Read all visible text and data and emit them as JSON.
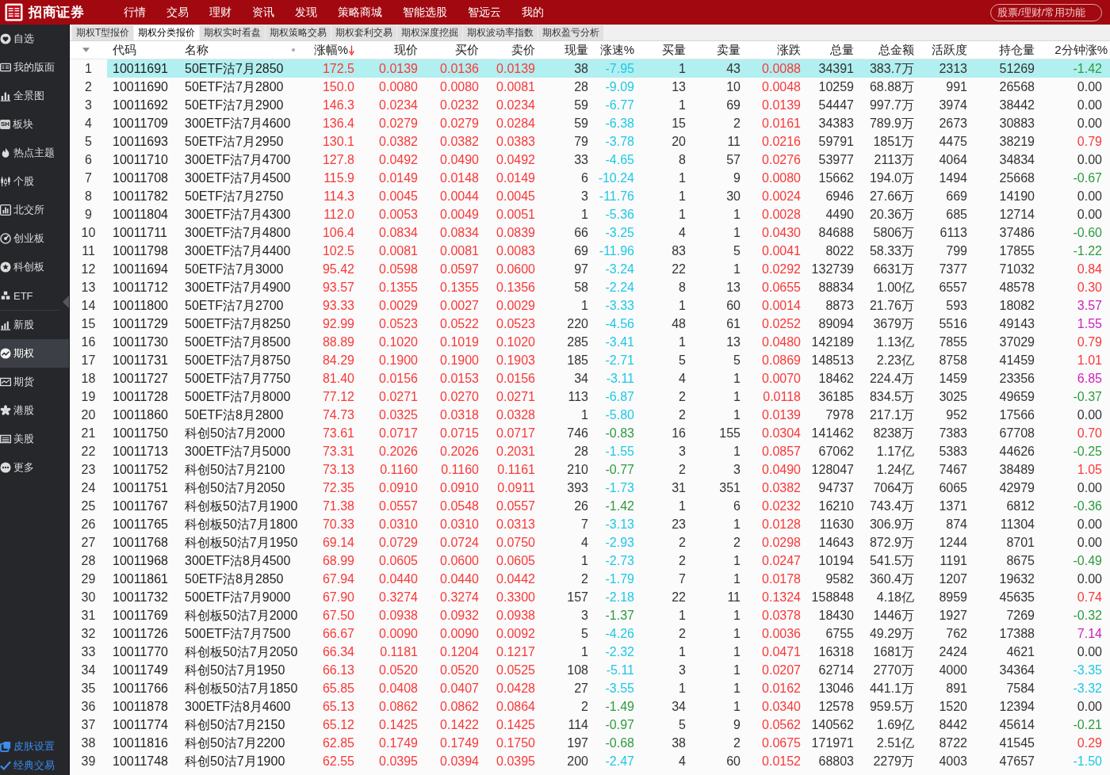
{
  "top_bar": {
    "brand": "招商证券",
    "menu": [
      "行情",
      "交易",
      "理财",
      "资讯",
      "发现",
      "策略商城",
      "智能选股",
      "智远云",
      "我的"
    ],
    "search": {
      "placeholder": "股票/理财/常用功能"
    }
  },
  "sidebar": {
    "sections": [
      {
        "items": [
          {
            "label": "自选",
            "selected": false
          },
          {
            "label": "我的版面",
            "selected": false
          },
          {
            "label": "全景图",
            "selected": false
          },
          {
            "label": "板块",
            "badge": "SH",
            "selected": false
          },
          {
            "label": "热点主题",
            "selected": false
          },
          {
            "label": "个股",
            "selected": false
          },
          {
            "label": "北交所",
            "selected": false
          },
          {
            "label": "创业板",
            "selected": false
          },
          {
            "label": "科创板",
            "selected": false
          },
          {
            "label": "ETF",
            "selected": false
          }
        ]
      },
      {
        "items": [
          {
            "label": "新股",
            "selected": false
          },
          {
            "label": "期权",
            "selected": true
          },
          {
            "label": "期货",
            "selected": false
          },
          {
            "label": "港股",
            "selected": false
          },
          {
            "label": "美股",
            "selected": false
          },
          {
            "label": "更多",
            "selected": false
          }
        ]
      }
    ],
    "footer": [
      "皮肤设置",
      "经典交易"
    ]
  },
  "tabs": [
    {
      "label": "期权T型报价",
      "selected": false
    },
    {
      "label": "期权分类报价",
      "selected": true
    },
    {
      "label": "期权实时看盘",
      "selected": false
    },
    {
      "label": "期权策略交易",
      "selected": false
    },
    {
      "label": "期权套利交易",
      "selected": false
    },
    {
      "label": "期权深度挖掘",
      "selected": false
    },
    {
      "label": "期权波动率指数",
      "selected": false
    },
    {
      "label": "期权盈亏分析",
      "selected": false
    }
  ],
  "table": {
    "columns": [
      {
        "label": "代码",
        "sorted": false
      },
      {
        "label": "名称",
        "sorted": false
      },
      {
        "label": "涨幅%",
        "sorted": true
      },
      {
        "label": "现价",
        "sorted": false
      },
      {
        "label": "买价",
        "sorted": false
      },
      {
        "label": "卖价",
        "sorted": false
      },
      {
        "label": "现量",
        "sorted": false
      },
      {
        "label": "涨速%",
        "sorted": false
      },
      {
        "label": "买量",
        "sorted": false
      },
      {
        "label": "卖量",
        "sorted": false
      },
      {
        "label": "涨跌",
        "sorted": false
      },
      {
        "label": "总量",
        "sorted": false
      },
      {
        "label": "总金额",
        "sorted": false
      },
      {
        "label": "活跃度",
        "sorted": false
      },
      {
        "label": "持仓量",
        "sorted": false
      },
      {
        "label": "2分钟涨%",
        "sorted": false
      }
    ],
    "rows": [
      {
        "no": "1",
        "selected": true,
        "cells": [
          "10011691",
          "50ETF沽7月2850",
          "172.5",
          "0.0139",
          "0.0136",
          "0.0139",
          "38",
          {
            "text": "-7.95",
            "color": "#1ec8e6"
          },
          "1",
          "43",
          "0.0088",
          "34391",
          "383.7万",
          "2313",
          "51269",
          {
            "text": "-1.42",
            "color": "#2e9b3f"
          }
        ]
      },
      {
        "no": "2",
        "selected": false,
        "cells": [
          "10011690",
          "50ETF沽7月2800",
          "150.0",
          "0.0080",
          "0.0080",
          "0.0081",
          "28",
          {
            "text": "-9.09",
            "color": "#1ec8e6"
          },
          "13",
          "10",
          "0.0048",
          "10259",
          "68.88万",
          "991",
          "26568",
          {
            "text": "0.00",
            "color": "#333333"
          }
        ]
      },
      {
        "no": "3",
        "selected": false,
        "cells": [
          "10011692",
          "50ETF沽7月2900",
          "146.3",
          "0.0234",
          "0.0232",
          "0.0234",
          "59",
          {
            "text": "-6.77",
            "color": "#1ec8e6"
          },
          "1",
          "69",
          "0.0139",
          "54447",
          "997.7万",
          "3974",
          "38442",
          {
            "text": "0.00",
            "color": "#333333"
          }
        ]
      },
      {
        "no": "4",
        "selected": false,
        "cells": [
          "10011709",
          "300ETF沽7月4600",
          "136.4",
          "0.0279",
          "0.0279",
          "0.0284",
          "59",
          {
            "text": "-6.38",
            "color": "#1ec8e6"
          },
          "15",
          "2",
          "0.0161",
          "34383",
          "789.9万",
          "2673",
          "30883",
          {
            "text": "0.00",
            "color": "#333333"
          }
        ]
      },
      {
        "no": "5",
        "selected": false,
        "cells": [
          "10011693",
          "50ETF沽7月2950",
          "130.1",
          "0.0382",
          "0.0382",
          "0.0383",
          "79",
          {
            "text": "-3.78",
            "color": "#1ec8e6"
          },
          "20",
          "11",
          "0.0216",
          "59791",
          "1851万",
          "4475",
          "38219",
          {
            "text": "0.79",
            "color": "#f93838"
          }
        ]
      },
      {
        "no": "6",
        "selected": false,
        "cells": [
          "10011710",
          "300ETF沽7月4700",
          "127.8",
          "0.0492",
          "0.0490",
          "0.0492",
          "33",
          {
            "text": "-4.65",
            "color": "#1ec8e6"
          },
          "8",
          "57",
          "0.0276",
          "53977",
          "2113万",
          "4064",
          "34834",
          {
            "text": "0.00",
            "color": "#333333"
          }
        ]
      },
      {
        "no": "7",
        "selected": false,
        "cells": [
          "10011708",
          "300ETF沽7月4500",
          "115.9",
          "0.0149",
          "0.0148",
          "0.0149",
          "6",
          {
            "text": "-10.24",
            "color": "#1ec8e6"
          },
          "1",
          "9",
          "0.0080",
          "15662",
          "194.0万",
          "1494",
          "25668",
          {
            "text": "-0.67",
            "color": "#2e9b3f"
          }
        ]
      },
      {
        "no": "8",
        "selected": false,
        "cells": [
          "10011782",
          "50ETF沽7月2750",
          "114.3",
          "0.0045",
          "0.0044",
          "0.0045",
          "3",
          {
            "text": "-11.76",
            "color": "#1ec8e6"
          },
          "1",
          "30",
          "0.0024",
          "6946",
          "27.66万",
          "669",
          "14190",
          {
            "text": "0.00",
            "color": "#333333"
          }
        ]
      },
      {
        "no": "9",
        "selected": false,
        "cells": [
          "10011804",
          "300ETF沽7月4300",
          "112.0",
          "0.0053",
          "0.0049",
          "0.0051",
          "1",
          {
            "text": "-5.36",
            "color": "#1ec8e6"
          },
          "1",
          "1",
          "0.0028",
          "4490",
          "20.36万",
          "685",
          "12714",
          {
            "text": "0.00",
            "color": "#333333"
          }
        ]
      },
      {
        "no": "10",
        "selected": false,
        "cells": [
          "10011711",
          "300ETF沽7月4800",
          "106.4",
          "0.0834",
          "0.0834",
          "0.0839",
          "66",
          {
            "text": "-3.25",
            "color": "#1ec8e6"
          },
          "4",
          "1",
          "0.0430",
          "84688",
          "5806万",
          "6113",
          "37486",
          {
            "text": "-0.60",
            "color": "#2e9b3f"
          }
        ]
      },
      {
        "no": "11",
        "selected": false,
        "cells": [
          "10011798",
          "300ETF沽7月4400",
          "102.5",
          "0.0081",
          "0.0081",
          "0.0083",
          "69",
          {
            "text": "-11.96",
            "color": "#1ec8e6"
          },
          "83",
          "5",
          "0.0041",
          "8022",
          "58.33万",
          "799",
          "17855",
          {
            "text": "-1.22",
            "color": "#2e9b3f"
          }
        ]
      },
      {
        "no": "12",
        "selected": false,
        "cells": [
          "10011694",
          "50ETF沽7月3000",
          "95.42",
          "0.0598",
          "0.0597",
          "0.0600",
          "97",
          {
            "text": "-3.24",
            "color": "#1ec8e6"
          },
          "22",
          "1",
          "0.0292",
          "132739",
          "6631万",
          "7377",
          "71032",
          {
            "text": "0.84",
            "color": "#f93838"
          }
        ]
      },
      {
        "no": "13",
        "selected": false,
        "cells": [
          "10011712",
          "300ETF沽7月4900",
          "93.57",
          "0.1355",
          "0.1355",
          "0.1356",
          "58",
          {
            "text": "-2.24",
            "color": "#1ec8e6"
          },
          "8",
          "13",
          "0.0655",
          "88834",
          "1.00亿",
          "6557",
          "48578",
          {
            "text": "0.30",
            "color": "#f93838"
          }
        ]
      },
      {
        "no": "14",
        "selected": false,
        "cells": [
          "10011800",
          "50ETF沽7月2700",
          "93.33",
          "0.0029",
          "0.0027",
          "0.0029",
          "1",
          {
            "text": "-3.33",
            "color": "#1ec8e6"
          },
          "1",
          "60",
          "0.0014",
          "8873",
          "21.76万",
          "593",
          "18082",
          {
            "text": "3.57",
            "color": "#cc22bb"
          }
        ]
      },
      {
        "no": "15",
        "selected": false,
        "cells": [
          "10011729",
          "500ETF沽7月8250",
          "92.99",
          "0.0523",
          "0.0522",
          "0.0523",
          "220",
          {
            "text": "-4.56",
            "color": "#1ec8e6"
          },
          "48",
          "61",
          "0.0252",
          "89094",
          "3679万",
          "5516",
          "49143",
          {
            "text": "1.55",
            "color": "#cc22bb"
          }
        ]
      },
      {
        "no": "16",
        "selected": false,
        "cells": [
          "10011730",
          "500ETF沽7月8500",
          "88.89",
          "0.1020",
          "0.1019",
          "0.1020",
          "285",
          {
            "text": "-3.41",
            "color": "#1ec8e6"
          },
          "1",
          "13",
          "0.0480",
          "142189",
          "1.13亿",
          "7855",
          "37029",
          {
            "text": "0.79",
            "color": "#f93838"
          }
        ]
      },
      {
        "no": "17",
        "selected": false,
        "cells": [
          "10011731",
          "500ETF沽7月8750",
          "84.29",
          "0.1900",
          "0.1900",
          "0.1903",
          "185",
          {
            "text": "-2.71",
            "color": "#1ec8e6"
          },
          "5",
          "5",
          "0.0869",
          "148513",
          "2.23亿",
          "8758",
          "41459",
          {
            "text": "1.01",
            "color": "#f93838"
          }
        ]
      },
      {
        "no": "18",
        "selected": false,
        "cells": [
          "10011727",
          "500ETF沽7月7750",
          "81.40",
          "0.0156",
          "0.0153",
          "0.0156",
          "34",
          {
            "text": "-3.11",
            "color": "#1ec8e6"
          },
          "4",
          "1",
          "0.0070",
          "18462",
          "224.4万",
          "1459",
          "23356",
          {
            "text": "6.85",
            "color": "#cc22bb"
          }
        ]
      },
      {
        "no": "19",
        "selected": false,
        "cells": [
          "10011728",
          "500ETF沽7月8000",
          "77.12",
          "0.0271",
          "0.0270",
          "0.0271",
          "113",
          {
            "text": "-6.87",
            "color": "#1ec8e6"
          },
          "2",
          "1",
          "0.0118",
          "36185",
          "834.5万",
          "3025",
          "49659",
          {
            "text": "-0.37",
            "color": "#2e9b3f"
          }
        ]
      },
      {
        "no": "20",
        "selected": false,
        "cells": [
          "10011860",
          "50ETF沽8月2800",
          "74.73",
          "0.0325",
          "0.0318",
          "0.0328",
          "1",
          {
            "text": "-5.80",
            "color": "#1ec8e6"
          },
          "2",
          "1",
          "0.0139",
          "7978",
          "217.1万",
          "952",
          "17566",
          {
            "text": "0.00",
            "color": "#333333"
          }
        ]
      },
      {
        "no": "21",
        "selected": false,
        "cells": [
          "10011750",
          "科创50沽7月2000",
          "73.61",
          "0.0717",
          "0.0715",
          "0.0717",
          "746",
          {
            "text": "-0.83",
            "color": "#2e9b3f"
          },
          "16",
          "155",
          "0.0304",
          "141462",
          "8238万",
          "7383",
          "67708",
          {
            "text": "0.70",
            "color": "#f93838"
          }
        ]
      },
      {
        "no": "22",
        "selected": false,
        "cells": [
          "10011713",
          "300ETF沽7月5000",
          "73.31",
          "0.2026",
          "0.2026",
          "0.2031",
          "28",
          {
            "text": "-1.55",
            "color": "#1ec8e6"
          },
          "3",
          "1",
          "0.0857",
          "67062",
          "1.17亿",
          "5383",
          "44626",
          {
            "text": "-0.25",
            "color": "#2e9b3f"
          }
        ]
      },
      {
        "no": "23",
        "selected": false,
        "cells": [
          "10011752",
          "科创50沽7月2100",
          "73.13",
          "0.1160",
          "0.1160",
          "0.1161",
          "210",
          {
            "text": "-0.77",
            "color": "#2e9b3f"
          },
          "2",
          "3",
          "0.0490",
          "128047",
          "1.24亿",
          "7467",
          "38489",
          {
            "text": "1.05",
            "color": "#f93838"
          }
        ]
      },
      {
        "no": "24",
        "selected": false,
        "cells": [
          "10011751",
          "科创50沽7月2050",
          "72.35",
          "0.0910",
          "0.0910",
          "0.0911",
          "393",
          {
            "text": "-1.73",
            "color": "#1ec8e6"
          },
          "31",
          "351",
          "0.0382",
          "94737",
          "7064万",
          "6065",
          "42979",
          {
            "text": "0.00",
            "color": "#333333"
          }
        ]
      },
      {
        "no": "25",
        "selected": false,
        "cells": [
          "10011767",
          "科创板50沽7月1900",
          "71.38",
          "0.0557",
          "0.0548",
          "0.0557",
          "26",
          {
            "text": "-1.42",
            "color": "#2e9b3f"
          },
          "1",
          "6",
          "0.0232",
          "16210",
          "743.4万",
          "1371",
          "6812",
          {
            "text": "-0.36",
            "color": "#2e9b3f"
          }
        ]
      },
      {
        "no": "26",
        "selected": false,
        "cells": [
          "10011765",
          "科创板50沽7月1800",
          "70.33",
          "0.0310",
          "0.0310",
          "0.0313",
          "7",
          {
            "text": "-3.13",
            "color": "#1ec8e6"
          },
          "23",
          "1",
          "0.0128",
          "11630",
          "306.9万",
          "874",
          "11304",
          {
            "text": "0.00",
            "color": "#333333"
          }
        ]
      },
      {
        "no": "27",
        "selected": false,
        "cells": [
          "10011768",
          "科创板50沽7月1950",
          "69.14",
          "0.0729",
          "0.0724",
          "0.0750",
          "4",
          {
            "text": "-2.93",
            "color": "#1ec8e6"
          },
          "2",
          "2",
          "0.0298",
          "14643",
          "872.9万",
          "1244",
          "8701",
          {
            "text": "0.00",
            "color": "#333333"
          }
        ]
      },
      {
        "no": "28",
        "selected": false,
        "cells": [
          "10011968",
          "300ETF沽8月4500",
          "68.99",
          "0.0605",
          "0.0600",
          "0.0605",
          "1",
          {
            "text": "-2.73",
            "color": "#1ec8e6"
          },
          "2",
          "1",
          "0.0247",
          "10194",
          "541.5万",
          "1191",
          "8675",
          {
            "text": "-0.49",
            "color": "#2e9b3f"
          }
        ]
      },
      {
        "no": "29",
        "selected": false,
        "cells": [
          "10011861",
          "50ETF沽8月2850",
          "67.94",
          "0.0440",
          "0.0440",
          "0.0442",
          "2",
          {
            "text": "-1.79",
            "color": "#1ec8e6"
          },
          "7",
          "1",
          "0.0178",
          "9582",
          "360.4万",
          "1207",
          "19632",
          {
            "text": "0.00",
            "color": "#333333"
          }
        ]
      },
      {
        "no": "30",
        "selected": false,
        "cells": [
          "10011732",
          "500ETF沽7月9000",
          "67.90",
          "0.3274",
          "0.3274",
          "0.3300",
          "157",
          {
            "text": "-2.18",
            "color": "#1ec8e6"
          },
          "22",
          "11",
          "0.1324",
          "158848",
          "4.18亿",
          "8959",
          "45635",
          {
            "text": "0.74",
            "color": "#f93838"
          }
        ]
      },
      {
        "no": "31",
        "selected": false,
        "cells": [
          "10011769",
          "科创板50沽7月2000",
          "67.50",
          "0.0938",
          "0.0932",
          "0.0938",
          "3",
          {
            "text": "-1.37",
            "color": "#2e9b3f"
          },
          "1",
          "1",
          "0.0378",
          "18430",
          "1446万",
          "1927",
          "7269",
          {
            "text": "-0.32",
            "color": "#2e9b3f"
          }
        ]
      },
      {
        "no": "32",
        "selected": false,
        "cells": [
          "10011726",
          "500ETF沽7月7500",
          "66.67",
          "0.0090",
          "0.0090",
          "0.0092",
          "5",
          {
            "text": "-4.26",
            "color": "#1ec8e6"
          },
          "2",
          "1",
          "0.0036",
          "6755",
          "49.29万",
          "762",
          "17388",
          {
            "text": "7.14",
            "color": "#cc22bb"
          }
        ]
      },
      {
        "no": "33",
        "selected": false,
        "cells": [
          "10011770",
          "科创板50沽7月2050",
          "66.34",
          "0.1181",
          "0.1204",
          "0.1217",
          "1",
          {
            "text": "-2.32",
            "color": "#1ec8e6"
          },
          "1",
          "1",
          "0.0471",
          "16318",
          "1681万",
          "2424",
          "4621",
          {
            "text": "0.00",
            "color": "#333333"
          }
        ]
      },
      {
        "no": "34",
        "selected": false,
        "cells": [
          "10011749",
          "科创50沽7月1950",
          "66.13",
          "0.0520",
          "0.0520",
          "0.0525",
          "108",
          {
            "text": "-5.11",
            "color": "#1ec8e6"
          },
          "3",
          "1",
          "0.0207",
          "62714",
          "2770万",
          "4000",
          "34364",
          {
            "text": "-3.35",
            "color": "#1ec8e6"
          }
        ]
      },
      {
        "no": "35",
        "selected": false,
        "cells": [
          "10011766",
          "科创板50沽7月1850",
          "65.85",
          "0.0408",
          "0.0407",
          "0.0428",
          "27",
          {
            "text": "-3.55",
            "color": "#1ec8e6"
          },
          "1",
          "1",
          "0.0162",
          "13046",
          "441.1万",
          "891",
          "7584",
          {
            "text": "-3.32",
            "color": "#1ec8e6"
          }
        ]
      },
      {
        "no": "36",
        "selected": false,
        "cells": [
          "10011878",
          "300ETF沽8月4600",
          "65.13",
          "0.0862",
          "0.0862",
          "0.0864",
          "2",
          {
            "text": "-1.49",
            "color": "#2e9b3f"
          },
          "34",
          "1",
          "0.0340",
          "12578",
          "959.5万",
          "1520",
          "12394",
          {
            "text": "0.00",
            "color": "#333333"
          }
        ]
      },
      {
        "no": "37",
        "selected": false,
        "cells": [
          "10011774",
          "科创50沽7月2150",
          "65.12",
          "0.1425",
          "0.1422",
          "0.1425",
          "114",
          {
            "text": "-0.97",
            "color": "#2e9b3f"
          },
          "5",
          "9",
          "0.0562",
          "140562",
          "1.69亿",
          "8442",
          "45614",
          {
            "text": "-0.21",
            "color": "#2e9b3f"
          }
        ]
      },
      {
        "no": "38",
        "selected": false,
        "cells": [
          "10011816",
          "科创50沽7月2200",
          "62.85",
          "0.1749",
          "0.1749",
          "0.1750",
          "197",
          {
            "text": "-0.68",
            "color": "#2e9b3f"
          },
          "38",
          "2",
          "0.0675",
          "171971",
          "2.51亿",
          "8722",
          "41545",
          {
            "text": "0.29",
            "color": "#f93838"
          }
        ]
      },
      {
        "no": "39",
        "selected": false,
        "cells": [
          "10011748",
          "科创50沽7月1900",
          "62.55",
          "0.0395",
          "0.0394",
          "0.0395",
          "200",
          {
            "text": "-2.47",
            "color": "#1ec8e6"
          },
          "4",
          "60",
          "0.0152",
          "68803",
          "2279万",
          "4003",
          "47657",
          {
            "text": "-1.50",
            "color": "#1ec8e6"
          }
        ]
      }
    ]
  }
}
